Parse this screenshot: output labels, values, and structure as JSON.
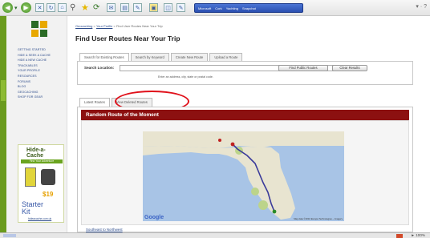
{
  "browser": {
    "toolbar_search": [
      "Microsoft",
      "Cork",
      "Yachting",
      "Snapchat"
    ],
    "right_text": "▾ · ?"
  },
  "sidebar": {
    "nav": [
      "Getting Started",
      "Hide & Seek a Cache",
      "Hide a New Cache",
      "Trackables",
      "Your Profile",
      "Resources",
      "Forums",
      "Blog",
      "Geocaching",
      "Shop for Gear"
    ],
    "ad": {
      "title_line1": "Hide-a-",
      "title_line2": "Cache",
      "subtitle": "Find Your Adventure",
      "price": "$19",
      "kit_line1": "Starter",
      "kit_line2": "Kit",
      "url": "hideacache.com.uk"
    }
  },
  "main": {
    "breadcrumb": {
      "link1": "Geocaching",
      "link2": "Your Profile",
      "current": "Find User Routes Near Your Trip"
    },
    "title": "Find User Routes Near Your Trip",
    "tabs": [
      "Search for Existing Routes",
      "Search by Keyword",
      "Create New Route",
      "Upload a Route"
    ],
    "search": {
      "label": "Search Location:",
      "value": "",
      "hint": "Enter an address, city, state or postal code.",
      "find_button": "Find Public Routes",
      "clear_button": "Clear Results"
    },
    "list_tabs": [
      "Latest Routes",
      "View Deleted Routes"
    ],
    "map": {
      "header": "Random Route of the Moment",
      "google": "Google",
      "credit": "Map data ©2010 Europa Technologies – Imagery",
      "route_link": "Southeast to Northwest"
    }
  },
  "status": {
    "right": "► 100%"
  },
  "colors": {
    "accent": "#8c1010",
    "highlight": "#e0101a",
    "leaf": "#6a9b1e"
  }
}
